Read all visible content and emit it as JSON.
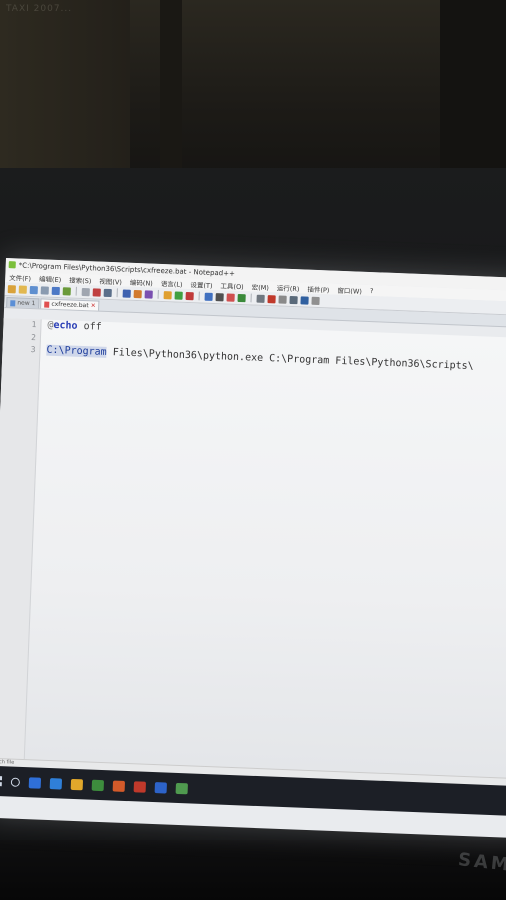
{
  "window": {
    "title": "*C:\\Program Files\\Python36\\Scripts\\cxfreeze.bat - Notepad++"
  },
  "menu": [
    "文件(F)",
    "编辑(E)",
    "搜索(S)",
    "视图(V)",
    "编码(N)",
    "语言(L)",
    "设置(T)",
    "工具(O)",
    "宏(M)",
    "运行(R)",
    "插件(P)",
    "窗口(W)",
    "?"
  ],
  "tabs": [
    {
      "label": "new 1",
      "active": false
    },
    {
      "label": "cxfreeze.bat",
      "active": true
    }
  ],
  "editor": {
    "line_numbers": [
      "1",
      "2",
      "3"
    ],
    "lines": [
      {
        "at": "@",
        "keyword": "echo",
        "rest": " off"
      },
      {
        "text": ""
      },
      {
        "highlight": "C:\\Program",
        "rest": " Files\\Python36\\python.exe C:\\Program Files\\Python36\\Scripts\\"
      }
    ]
  },
  "statusbar": {
    "text": "Batch file"
  },
  "monitor": {
    "brand": "SAM"
  },
  "wall_text": "TAXI 2007...",
  "colors": {
    "toolbar_icons": [
      "#d9a23a",
      "#e2b850",
      "#5f8fcf",
      "#8a9bb0",
      "#4d79c6",
      "#6a9a3a",
      "#a0a6b0",
      "#c04040",
      "#5b6f8a",
      "#3f62b0",
      "#d27a2e",
      "#7a4fb0",
      "#e0a030",
      "#40a040",
      "#c03a3a",
      "#4070c0",
      "#505050",
      "#d05050",
      "#3a8a3a",
      "#707880",
      "#c0392b",
      "#8a8a8a",
      "#5a6a7a",
      "#3060a0",
      "#909090"
    ],
    "taskbar_icons": [
      "#2f6fd8",
      "#2f7fd8",
      "#e2a82b",
      "#3d8c3d",
      "#d35a2a",
      "#c0392b",
      "#2d63c9",
      "#4f9a4f"
    ]
  },
  "icons": {
    "app": "notepad-plus-plus-icon",
    "windows_start": "windows-start-icon"
  }
}
